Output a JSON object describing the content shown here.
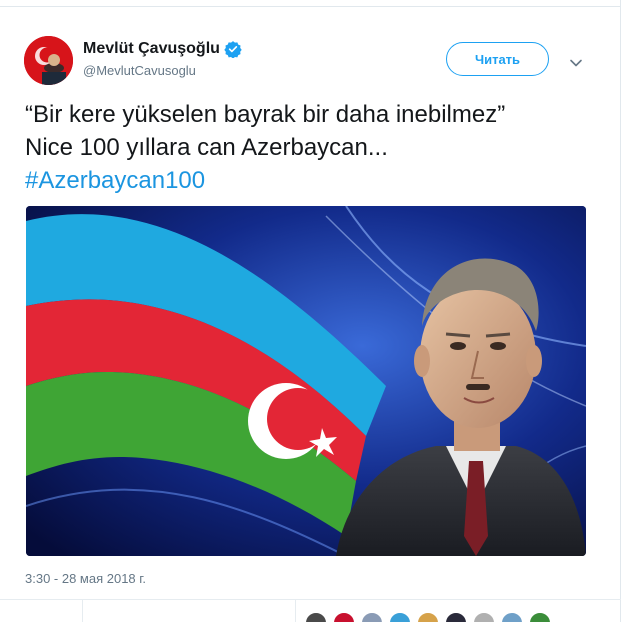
{
  "tweet": {
    "author_name": "Mevlüt Çavuşoğlu",
    "author_handle": "@MevlutCavusoglu",
    "follow_label": "Читать",
    "text_line1": "“Bir kere yükselen bayrak bir daha inebilmez”",
    "text_line2": "Nice 100 yıllara can Azerbaycan...",
    "hashtag": "#Azerbaycan100",
    "timestamp": "3:30 - 28 мая 2018 г."
  },
  "icons": {
    "verified": "verified-badge-icon",
    "chevron": "chevron-down-icon"
  },
  "colors": {
    "accent": "#1da1f2",
    "hashtag": "#1b95e0",
    "text_primary": "#14171a",
    "text_secondary": "#657786",
    "flag_blue": "#00b5e2",
    "flag_red": "#ef3340",
    "flag_green": "#509e2f"
  }
}
